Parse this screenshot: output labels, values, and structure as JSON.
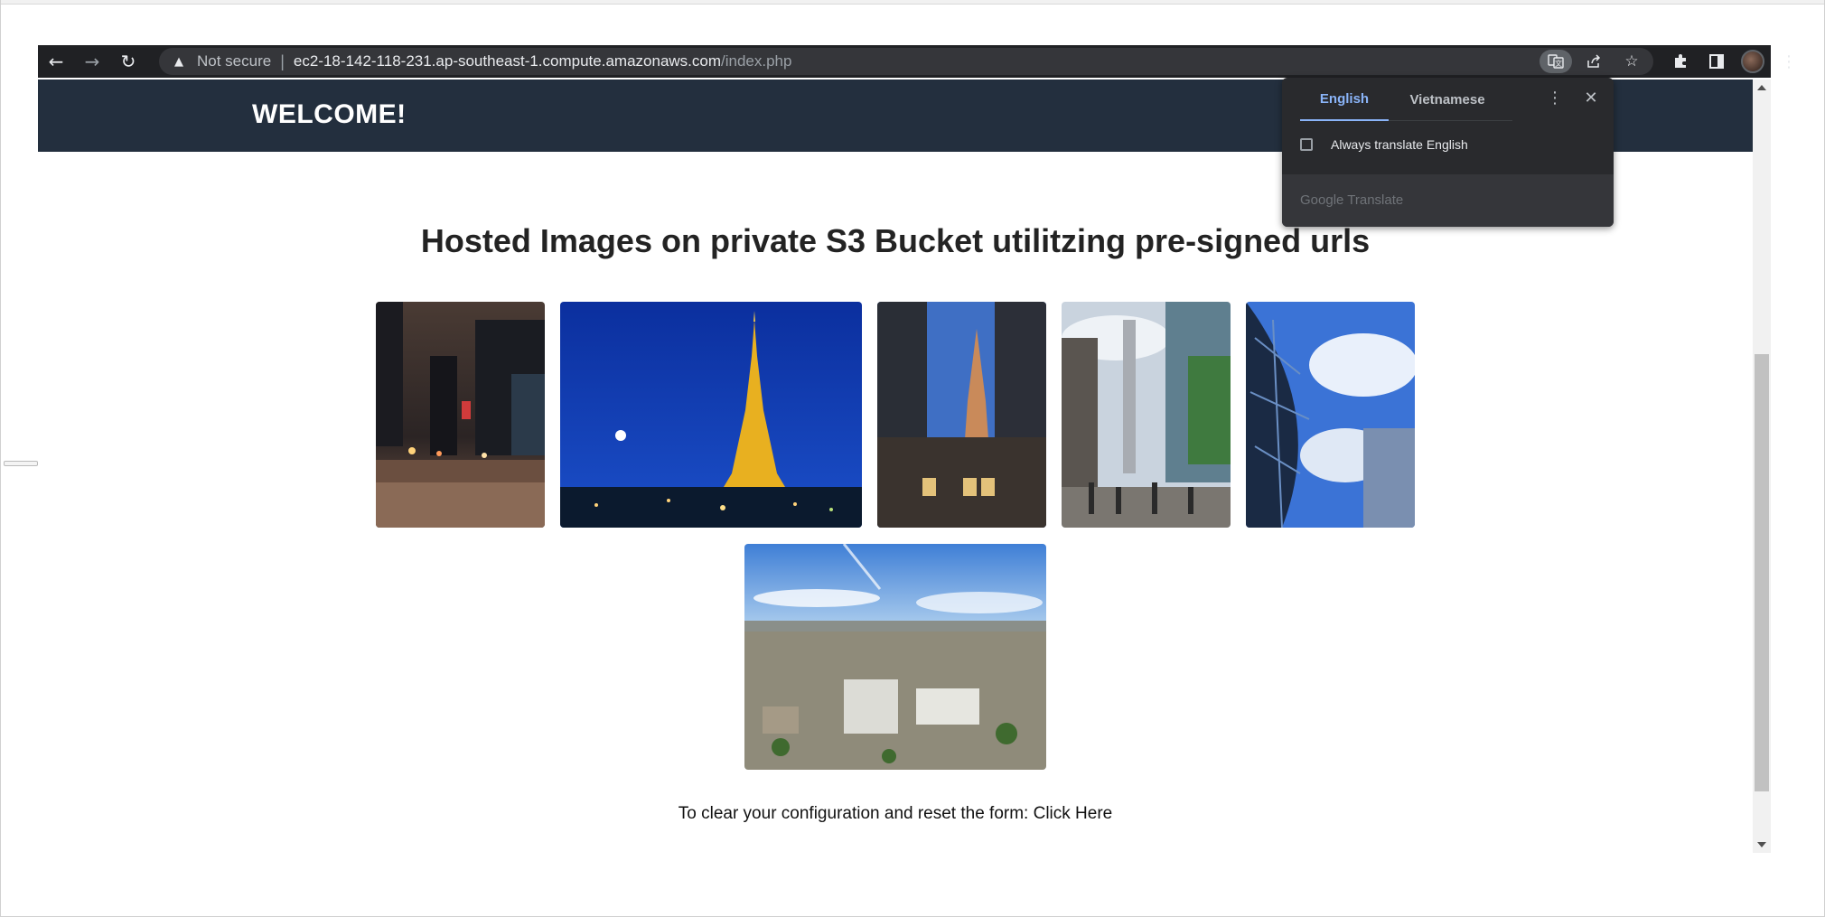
{
  "browser": {
    "security_label": "Not secure",
    "url_host": "ec2-18-142-118-231.ap-southeast-1.compute.amazonaws.com",
    "url_path": "/index.php"
  },
  "page": {
    "welcome": "WELCOME!",
    "title": "Hosted Images on private S3 Bucket utilitzing pre-signed urls",
    "footer_text": "To clear your configuration and reset the form: Click Here"
  },
  "translate_popup": {
    "tab_source": "English",
    "tab_target": "Vietnamese",
    "always_translate_label": "Always translate English",
    "always_translate_checked": false,
    "brand": "Google Translate"
  },
  "colors": {
    "header_bg": "#232f3e",
    "toolbar_bg": "#202124",
    "popup_accent": "#8ab4f8"
  }
}
